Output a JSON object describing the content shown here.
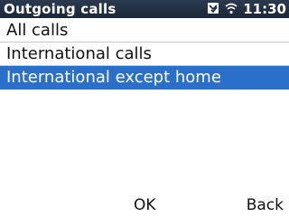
{
  "status": {
    "title": "Outgoing calls",
    "time": "11:30",
    "icons": [
      "message-icon",
      "wifi-icon"
    ]
  },
  "menu": {
    "items": [
      {
        "label": "All calls",
        "selected": false
      },
      {
        "label": "International calls",
        "selected": false
      },
      {
        "label": "International except home",
        "selected": true
      }
    ]
  },
  "softkeys": {
    "left": "",
    "center": "OK",
    "right": "Back"
  },
  "colors": {
    "statusbar": "#1c2738",
    "selection": "#2a6fc9",
    "text": "#111111"
  }
}
